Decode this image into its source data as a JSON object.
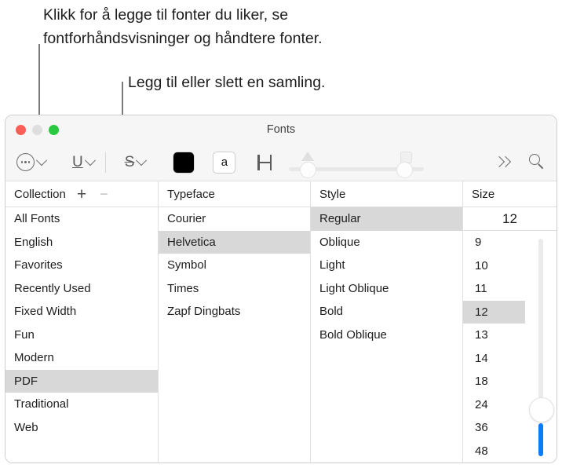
{
  "callouts": [
    {
      "id": "callout-1",
      "text": "Klikk for å legge til fonter du liker, se\nfontforhåndsvisninger og håndtere fonter."
    },
    {
      "id": "callout-2",
      "text": "Legg til eller slett en samling."
    }
  ],
  "window": {
    "title": "Fonts",
    "traffic_lights": {
      "close_label": "Close",
      "minimize_label": "Minimize",
      "zoom_label": "Zoom"
    }
  },
  "toolbar": {
    "actions_menu_label": "Actions",
    "underline_label": "U",
    "strikethrough_label": "S",
    "text_color_label": "Text Color",
    "text_color_hex": "#000000",
    "document_color_label": "a",
    "kerning_label": "Text Spacing",
    "shadow_opacity_label": "Shadow Opacity",
    "shadow_blur_label": "Shadow Blur",
    "overflow_label": "More",
    "search_label": "Search"
  },
  "columns": {
    "collection": "Collection",
    "typeface": "Typeface",
    "style": "Style",
    "size": "Size",
    "add_label": "+",
    "remove_label": "−"
  },
  "collections": {
    "items": [
      "All Fonts",
      "English",
      "Favorites",
      "Recently Used",
      "Fixed Width",
      "Fun",
      "Modern",
      "PDF",
      "Traditional",
      "Web"
    ],
    "selected": "PDF"
  },
  "typefaces": {
    "items": [
      "Courier",
      "Helvetica",
      "Symbol",
      "Times",
      "Zapf Dingbats"
    ],
    "selected": "Helvetica"
  },
  "styles": {
    "items": [
      "Regular",
      "Oblique",
      "Light",
      "Light Oblique",
      "Bold",
      "Bold Oblique"
    ],
    "selected": "Regular"
  },
  "sizes": {
    "value": "12",
    "items": [
      "9",
      "10",
      "11",
      "12",
      "13",
      "14",
      "18",
      "24",
      "36",
      "48"
    ],
    "selected": "12",
    "slider_accent_hex": "#0a7cf6"
  }
}
